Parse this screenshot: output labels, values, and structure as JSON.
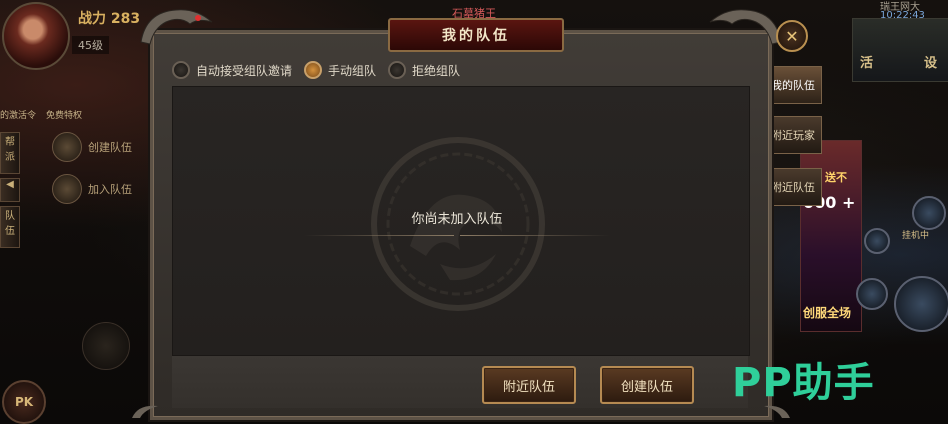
{
  "hud": {
    "power": "战力 283",
    "level": "45级",
    "sidebar_promo_a": "的激活令",
    "sidebar_promo_b": "免费特权",
    "side_tabs": [
      "帮",
      "派",
      "队",
      "伍"
    ],
    "side_actions": [
      {
        "label": "创建队伍",
        "icon": "flag-icon"
      },
      {
        "label": "加入队伍",
        "icon": "people-icon"
      }
    ],
    "pk_label": "PK"
  },
  "scene": {
    "boss_name": "石墓猪王",
    "server": "瑞王网大",
    "clock": "10:22:43",
    "minimap_buttons": [
      "活",
      "设"
    ],
    "promo_title": "送不",
    "promo_value": "000 +",
    "promo_footer": "创服全场",
    "fighting_label": "挂机中"
  },
  "dialog": {
    "title": "我的队伍",
    "close_label": "✕",
    "tabs": [
      {
        "label": "我的队伍",
        "active": true
      },
      {
        "label": "附近玩家",
        "active": false
      },
      {
        "label": "附近队伍",
        "active": false
      }
    ],
    "options": [
      {
        "label": "自动接受组队邀请",
        "selected": false
      },
      {
        "label": "手动组队",
        "selected": true
      },
      {
        "label": "拒绝组队",
        "selected": false
      }
    ],
    "empty_message": "你尚未加入队伍",
    "buttons": {
      "nearby": "附近队伍",
      "create": "创建队伍"
    }
  },
  "watermark": "PP助手",
  "colors": {
    "accent_gold": "#b58a52",
    "title_red": "#5a1510",
    "radio_on": "#d4923e",
    "watermark": "#2fcf9a"
  }
}
